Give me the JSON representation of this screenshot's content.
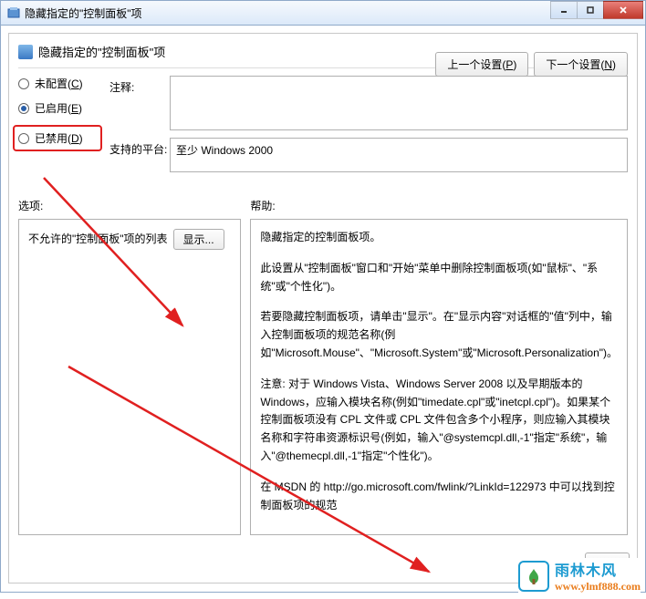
{
  "titlebar": {
    "text": "隐藏指定的\"控制面板\"项"
  },
  "header": {
    "title": "隐藏指定的\"控制面板\"项"
  },
  "nav": {
    "prev": "上一个设置(",
    "prev_key": "P",
    "prev_suffix": ")",
    "next": "下一个设置(",
    "next_key": "N",
    "next_suffix": ")"
  },
  "radios": {
    "not_configured": "未配置(",
    "not_configured_key": "C",
    "enabled": "已启用(",
    "enabled_key": "E",
    "disabled": "已禁用(",
    "disabled_key": "D",
    "close_paren": ")"
  },
  "fields": {
    "note_label": "注释:",
    "note_value": "",
    "platform_label": "支持的平台:",
    "platform_value": "至少 Windows 2000"
  },
  "columns": {
    "options_label": "选项:",
    "help_label": "帮助:"
  },
  "options": {
    "list_label": "不允许的\"控制面板\"项的列表",
    "show_btn": "显示..."
  },
  "help": {
    "p1": "隐藏指定的控制面板项。",
    "p2": "此设置从\"控制面板\"窗口和\"开始\"菜单中删除控制面板项(如\"鼠标\"、\"系统\"或\"个性化\")。",
    "p3": "若要隐藏控制面板项，请单击\"显示\"。在\"显示内容\"对话框的\"值\"列中，输入控制面板项的规范名称(例如\"Microsoft.Mouse\"、\"Microsoft.System\"或\"Microsoft.Personalization\")。",
    "p4": "注意: 对于 Windows Vista、Windows Server 2008 以及早期版本的 Windows，应输入模块名称(例如\"timedate.cpl\"或\"inetcpl.cpl\")。如果某个控制面板项没有 CPL 文件或 CPL 文件包含多个小程序，则应输入其模块名称和字符串资源标识号(例如，输入\"@systemcpl.dll,-1\"指定\"系统\"，输入\"@themecpl.dll,-1\"指定\"个性化\")。",
    "p5": "在 MSDN 的 http://go.microsoft.com/fwlink/?LinkId=122973 中可以找到控制面板项的规范"
  },
  "watermark": {
    "cn": "雨林木风",
    "url": "www.ylmf888.com"
  }
}
